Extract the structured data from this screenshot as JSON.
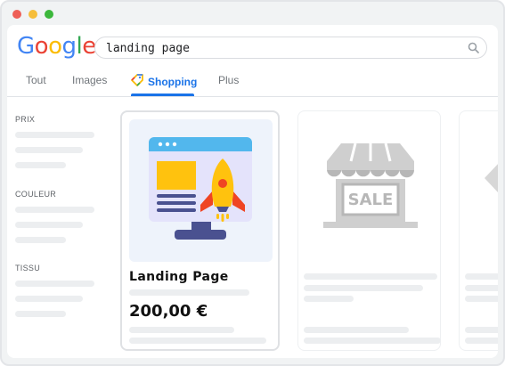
{
  "search": {
    "query": "landing page"
  },
  "logo": {
    "letters": [
      "G",
      "o",
      "o",
      "g",
      "l",
      "e"
    ],
    "colors": [
      "#4285f4",
      "#ea4335",
      "#fbbc05",
      "#4285f4",
      "#34a853",
      "#ea4335"
    ]
  },
  "tabs": [
    {
      "label": "Tout"
    },
    {
      "label": "Images"
    },
    {
      "label": "Shopping",
      "active": true
    },
    {
      "label": "Plus"
    }
  ],
  "filters": [
    {
      "label": "PRIX"
    },
    {
      "label": "COULEUR"
    },
    {
      "label": "TISSU"
    }
  ],
  "products": [
    {
      "title": "Landing Page",
      "price": "200,00 €"
    }
  ],
  "placeholder": {
    "sign_text": "SALE"
  },
  "colors": {
    "accent": "#1a73e8",
    "skeleton": "#eceef0"
  }
}
